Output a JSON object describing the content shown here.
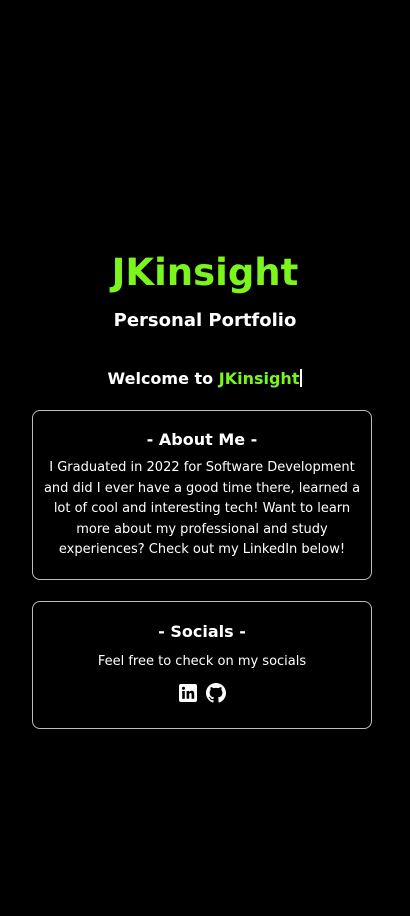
{
  "header": {
    "brand": "JKinsight",
    "subtitle": "Personal Portfolio"
  },
  "welcome": {
    "prefix": "Welcome to ",
    "highlight": "JKinsight"
  },
  "about": {
    "title": "- About Me -",
    "text": "I Graduated in 2022 for Software Development and did I ever have a good time there, learned a lot of cool and interesting tech! Want to learn more about my professional and study experiences? Check out my LinkedIn below!"
  },
  "socials": {
    "title": "- Socials -",
    "text": "Feel free to check on my socials",
    "icons": [
      "linkedin-icon",
      "github-icon"
    ]
  },
  "colors": {
    "background": "#000000",
    "accent": "#7cf51c",
    "text": "#ffffff",
    "card_border": "#bdbdbd"
  }
}
